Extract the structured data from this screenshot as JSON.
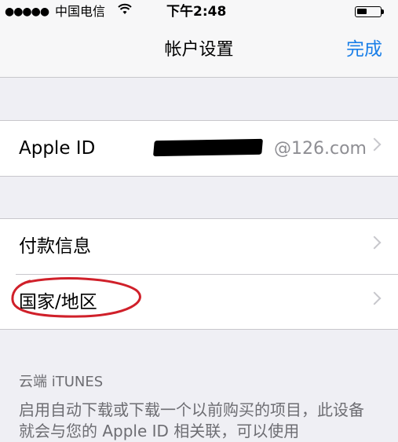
{
  "status_bar": {
    "signal": "●●●●●",
    "carrier": "中国电信",
    "wifi_icon": "wifi-icon",
    "time": "下午2:48",
    "battery_icon": "battery-icon"
  },
  "nav": {
    "title": "帐户设置",
    "done_label": "完成"
  },
  "account": {
    "apple_id_label": "Apple ID",
    "apple_id_value": "@126.com"
  },
  "settings": {
    "items": [
      {
        "label": "付款信息"
      },
      {
        "label": "国家/地区"
      }
    ]
  },
  "itunes_section": {
    "header": "云端 iTUNES",
    "footer": "启用自动下载或下载一个以前购买的项目，此设备就会与您的 Apple ID 相关联，可以使用"
  },
  "colors": {
    "accent": "#1a7fe8",
    "annotation": "#d0202a"
  }
}
